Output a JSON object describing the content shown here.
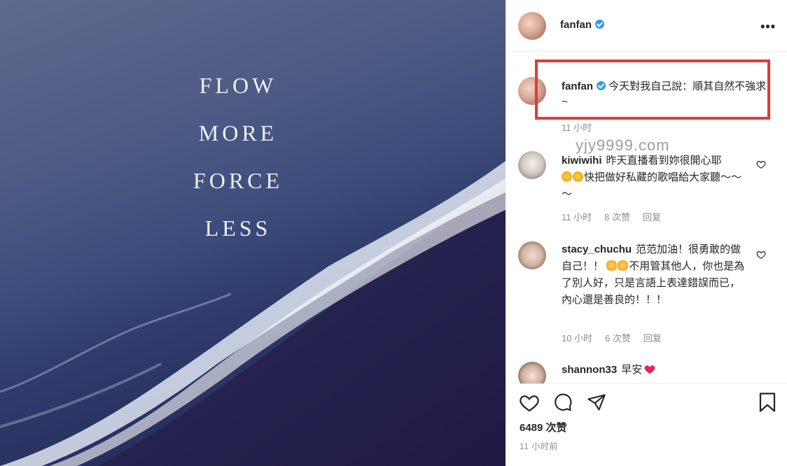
{
  "photo": {
    "quote_lines": [
      "FLOW",
      "MORE",
      "FORCE",
      "LESS"
    ]
  },
  "header": {
    "username": "fanfan",
    "more": "•••"
  },
  "caption": {
    "username": "fanfan",
    "text": "今天對我自己說：順其自然不強求~",
    "time": "11 小时"
  },
  "watermark": "yjy9999.com",
  "comments": [
    {
      "username": "kiwiwihi",
      "text_a": "昨天直播看到妳很開心耶",
      "text_b": "快把做好私藏的歌唱給大家聽～～～",
      "time": "11 小时",
      "likes": "8 次赞",
      "reply": "回复"
    },
    {
      "username": "stacy_chuchu",
      "text_a": "范范加油！很勇敢的做自己！！",
      "text_b": "不用管其他人，你也是為了別人好，只是言語上表達錯誤而已，內心還是善良的！！！",
      "time": "10 小时",
      "likes": "6 次赞",
      "reply": "回复"
    },
    {
      "username": "shannon33",
      "text_a": "早安"
    }
  ],
  "footer": {
    "likes": "6489 次赞",
    "time": "11 小时前"
  },
  "colors": {
    "highlight": "#e53935",
    "verified": "#3897f0",
    "heart_red": "#e0245e"
  }
}
